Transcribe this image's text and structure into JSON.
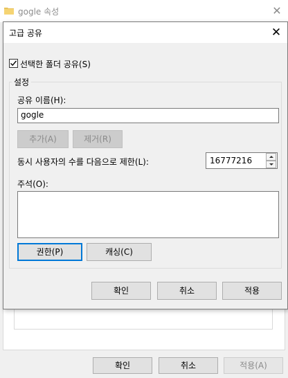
{
  "background_window": {
    "title": "gogle 속성",
    "buttons": {
      "ok": "확인",
      "cancel": "취소",
      "apply": "적용(A)"
    }
  },
  "dialog": {
    "title": "고급 공유",
    "share_checkbox": {
      "label": "선택한 폴더 공유(S)",
      "checked": true
    },
    "settings": {
      "legend": "설정",
      "share_name_label": "공유 이름(H):",
      "share_name_value": "gogle",
      "add_button": "추가(A)",
      "remove_button": "제거(R)",
      "limit_label": "동시 사용자의 수를 다음으로 제한(L):",
      "limit_value": "16777216",
      "comment_label": "주석(O):",
      "comment_value": "",
      "permissions_button": "권한(P)",
      "caching_button": "캐싱(C)"
    },
    "buttons": {
      "ok": "확인",
      "cancel": "취소",
      "apply": "적용"
    }
  },
  "colors": {
    "focus_accent": "#0078d7",
    "dialog_bg": "#f0f0f0",
    "disabled_text": "#8a8a8a"
  }
}
